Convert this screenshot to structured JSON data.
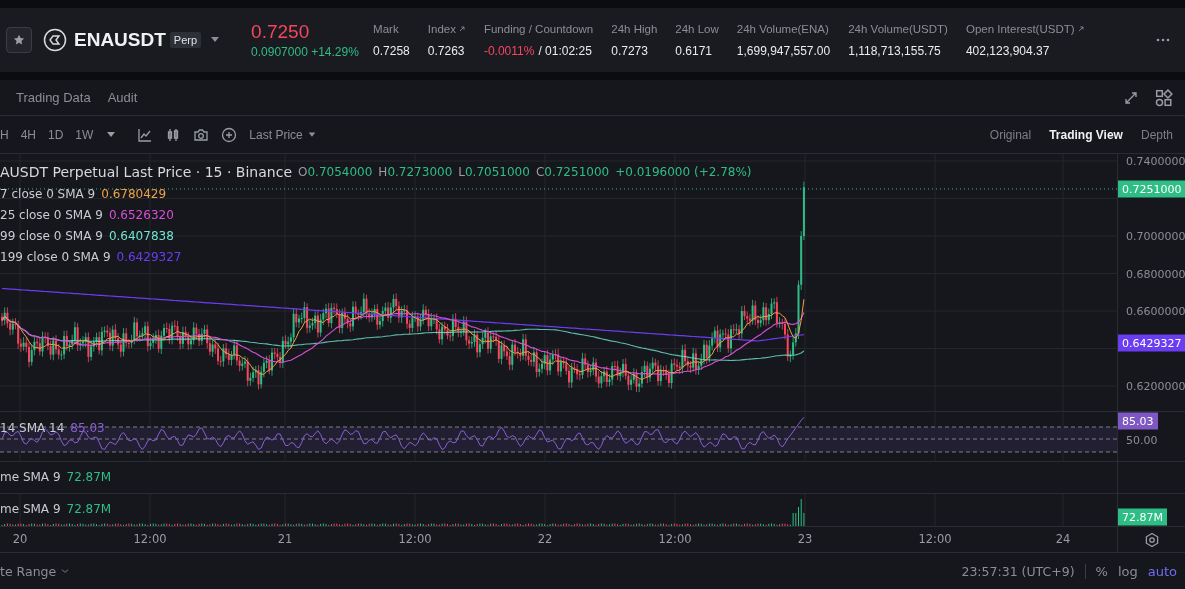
{
  "header": {
    "symbol": "ENAUSDT",
    "badge": "Perp",
    "price": "0.7250",
    "change": "0.0907000",
    "change_pct": "+14.29%",
    "stats": [
      {
        "kind": "plain",
        "label": "Mark",
        "value": "0.7258",
        "link": false
      },
      {
        "kind": "plain",
        "label": "Index",
        "value": "0.7263",
        "link": true
      },
      {
        "kind": "funding",
        "label": "Funding / Countdown",
        "value": "-0.0011%",
        "countdown": "/ 01:02:25",
        "link": false
      },
      {
        "kind": "plain",
        "label": "24h High",
        "value": "0.7273",
        "link": false
      },
      {
        "kind": "plain",
        "label": "24h Low",
        "value": "0.6171",
        "link": false
      },
      {
        "kind": "plain",
        "label": "24h Volume(ENA)",
        "value": "1,699,947,557.00",
        "link": false
      },
      {
        "kind": "plain",
        "label": "24h Volume(USDT)",
        "value": "1,118,713,155.75",
        "link": false
      },
      {
        "kind": "plain",
        "label": "Open Interest(USDT)",
        "value": "402,123,904.37",
        "link": true
      }
    ]
  },
  "tabs": [
    {
      "label": "Trading Data"
    },
    {
      "label": "Audit"
    }
  ],
  "toolbar": {
    "intervals": [
      "H",
      "4H",
      "1D",
      "1W"
    ],
    "price_source": "Last Price"
  },
  "views": [
    {
      "label": "Original",
      "selected": false
    },
    {
      "label": "Trading View",
      "selected": true
    },
    {
      "label": "Depth",
      "selected": false
    }
  ],
  "chart": {
    "title": "AUSDT Perpetual Last Price · 15 · Binance",
    "ohlc": [
      {
        "key": "O",
        "value": "0.7054000"
      },
      {
        "key": "H",
        "value": "0.7273000"
      },
      {
        "key": "L",
        "value": "0.7051000"
      },
      {
        "key": "C",
        "value": "0.7251000"
      }
    ],
    "change": "+0.0196000 (+2.78%)",
    "indicators": [
      {
        "label": "7 close 0 SMA 9",
        "value": "0.6780429",
        "color": "#f0a04b"
      },
      {
        "label": "25 close 0 SMA 9",
        "value": "0.6526320",
        "color": "#d84fd8"
      },
      {
        "label": "99 close 0 SMA 9",
        "value": "0.6407838",
        "color": "#6fe6cf"
      },
      {
        "label": "199 close 0 SMA 9",
        "value": "0.6429327",
        "color": "#6a3df0"
      }
    ],
    "price_ticks": [
      "0.7400000",
      "0.7000000",
      "0.6800000",
      "0.6600000",
      "0.6200000"
    ],
    "last_price_label": "0.7251000",
    "ma_label": "0.6429327",
    "rsi": {
      "label": "14 SMA 14",
      "value": "85.03",
      "tag_value": "85.03",
      "mid_tick": "50.00"
    },
    "volume_panes": [
      {
        "label": "me SMA 9",
        "value": "72.87M"
      },
      {
        "label": "me SMA 9",
        "value": "72.87M"
      }
    ],
    "axis_volume_label": "72.87M",
    "time_ticks": [
      "20",
      "12:00",
      "21",
      "12:00",
      "22",
      "12:00",
      "23",
      "12:00",
      "24"
    ]
  },
  "footer": {
    "range": "te Range",
    "time": "23:57:31 (UTC+9)",
    "options": [
      {
        "label": "%",
        "selected": false
      },
      {
        "label": "log",
        "selected": false
      },
      {
        "label": "auto",
        "selected": true
      }
    ]
  }
}
